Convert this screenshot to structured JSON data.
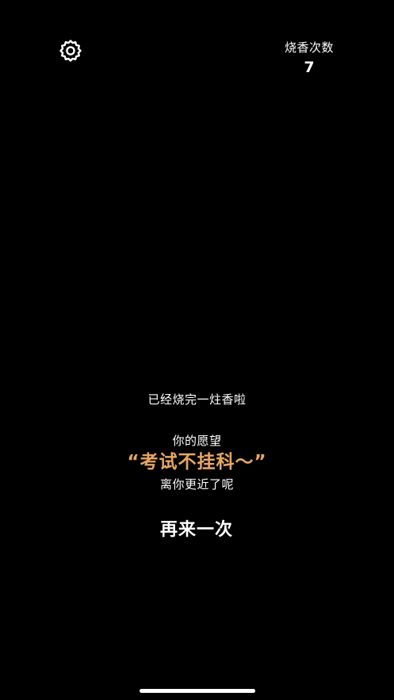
{
  "header": {
    "settings_icon": "gear-icon",
    "counter_label": "烧香次数",
    "counter_value": "7"
  },
  "result": {
    "burned_message": "已经烧完一炷香啦",
    "wish_label": "你的愿望",
    "wish_open_quote": "“",
    "wish_text": "考试不挂科～",
    "wish_close_quote": "”",
    "closer_message": "离你更近了呢"
  },
  "actions": {
    "again_label": "再来一次"
  },
  "colors": {
    "background": "#000000",
    "text": "#ffffff",
    "wish_accent": "#e8a662"
  }
}
